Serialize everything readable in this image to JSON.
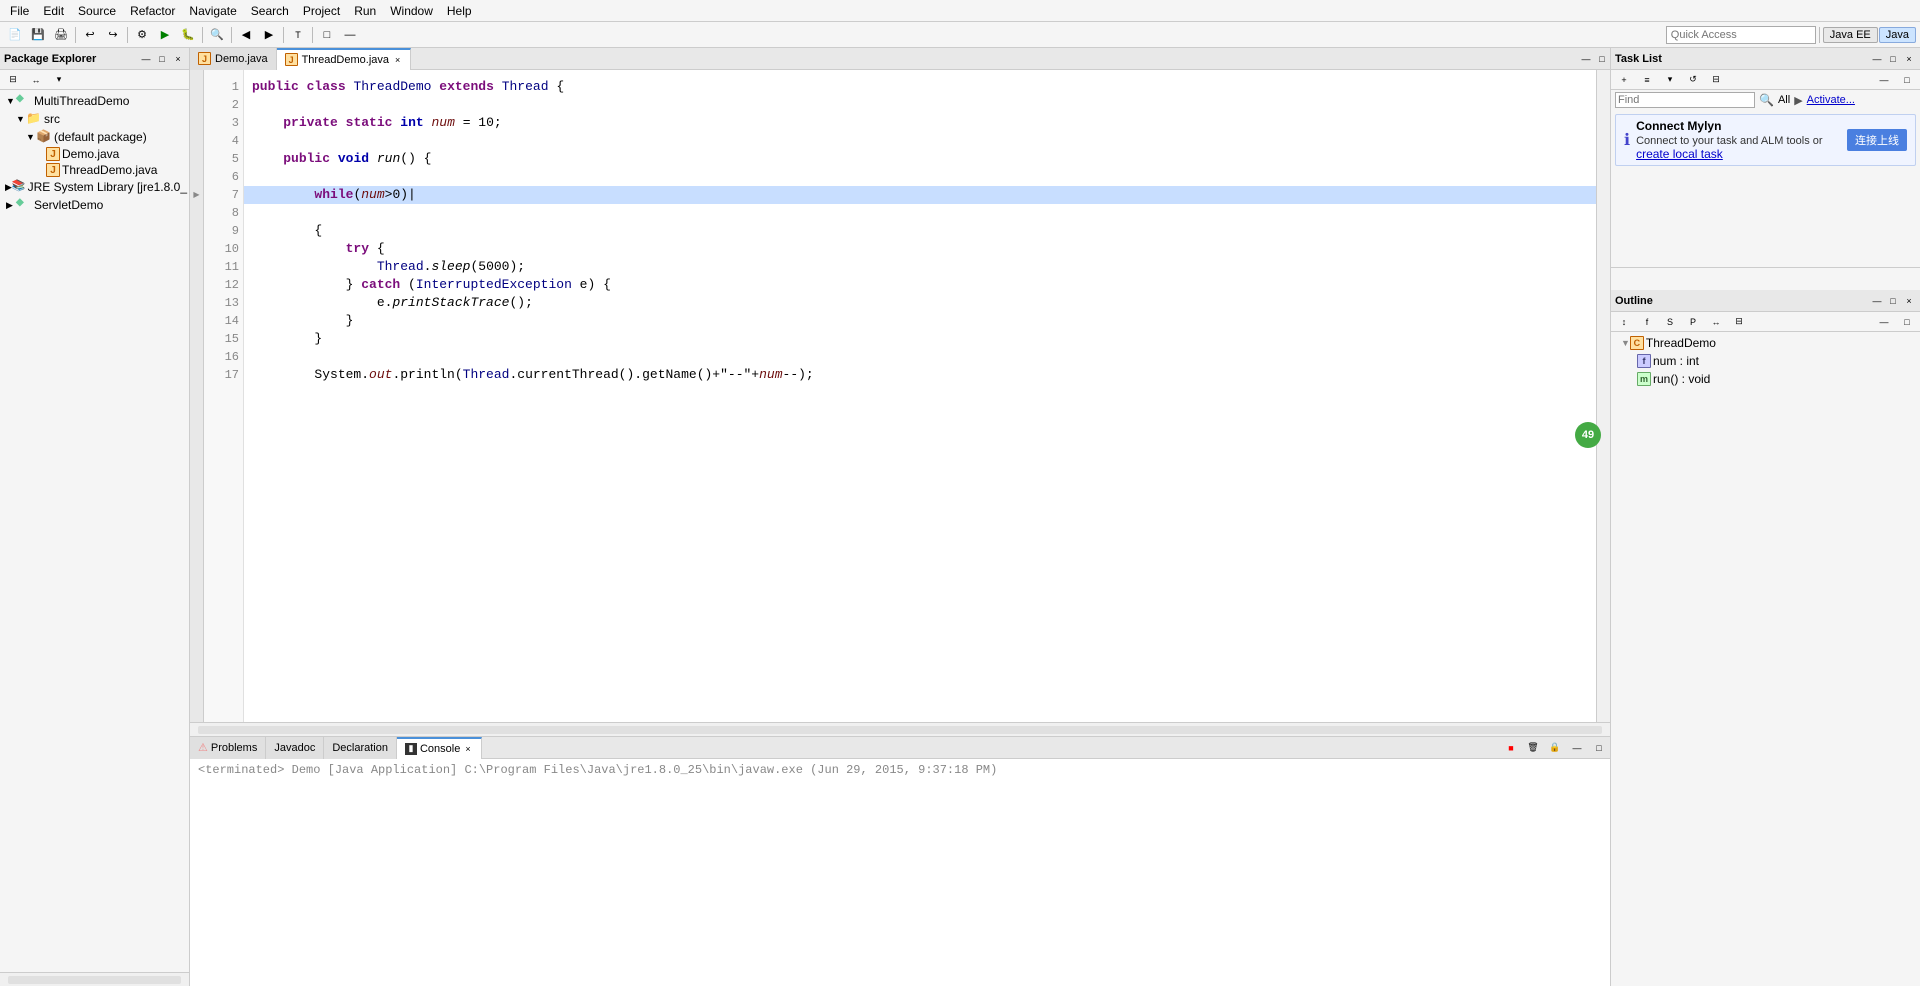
{
  "app": {
    "title": "Eclipse IDE"
  },
  "menubar": {
    "items": [
      "File",
      "Edit",
      "Source",
      "Refactor",
      "Navigate",
      "Search",
      "Project",
      "Run",
      "Window",
      "Help"
    ]
  },
  "quickaccess": {
    "placeholder": "Quick Access",
    "perspective1": "Java EE",
    "perspective2": "Java"
  },
  "left_panel": {
    "title": "Package Explorer",
    "close_label": "×",
    "minimize_label": "—",
    "maximize_label": "□",
    "tree": [
      {
        "label": "MultiThreadDemo",
        "type": "project",
        "indent": 0,
        "expanded": true
      },
      {
        "label": "src",
        "type": "folder",
        "indent": 1,
        "expanded": true
      },
      {
        "label": "(default package)",
        "type": "package",
        "indent": 2,
        "expanded": true
      },
      {
        "label": "Demo.java",
        "type": "java",
        "indent": 3
      },
      {
        "label": "ThreadDemo.java",
        "type": "java",
        "indent": 3
      },
      {
        "label": "JRE System Library [jre1.8.0_",
        "type": "library",
        "indent": 2
      },
      {
        "label": "ServletDemo",
        "type": "project",
        "indent": 0
      }
    ]
  },
  "editor": {
    "tabs": [
      {
        "label": "Demo.java",
        "active": false,
        "icon": "java-file-icon"
      },
      {
        "label": "ThreadDemo.java",
        "active": true,
        "icon": "java-file-icon"
      }
    ],
    "code_lines": [
      "",
      "public class ThreadDemo extends Thread {",
      "",
      "    private static int num = 10;",
      "",
      "    public void run() {",
      "",
      "        while(num>0)|",
      "        {",
      "            try {",
      "                Thread.sleep(5000);",
      "            } catch (InterruptedException e) {",
      "                e.printStackTrace();",
      "            }",
      "        }",
      "",
      "        System.out.println(Thread.currentThread().getName()+\"--\"+num--);",
      ""
    ],
    "highlight_line": 8
  },
  "bottom_panel": {
    "tabs": [
      "Problems",
      "Javadoc",
      "Declaration",
      "Console"
    ],
    "active_tab": "Console",
    "console_text": "<terminated> Demo [Java Application] C:\\Program Files\\Java\\jre1.8.0_25\\bin\\javaw.exe (Jun 29, 2015, 9:37:18 PM)"
  },
  "right_panel": {
    "task_list": {
      "title": "Task List",
      "find_placeholder": "Find",
      "all_label": "All",
      "activate_label": "Activate..."
    },
    "mylyn": {
      "connect_label": "Connect Mylyn",
      "description": "Connect to your task and ALM tools or",
      "link_label": "create local task",
      "button_label": "连接上线"
    },
    "outline": {
      "title": "Outline",
      "tree": [
        {
          "label": "ThreadDemo",
          "type": "class",
          "indent": 0,
          "expanded": true
        },
        {
          "label": "num : int",
          "type": "field",
          "indent": 1
        },
        {
          "label": "run() : void",
          "type": "method",
          "indent": 1
        }
      ]
    }
  },
  "icons": {
    "project": "▶",
    "folder": "📁",
    "package": "📦",
    "java_file": "J",
    "library": "📚",
    "class": "C",
    "field": "f",
    "method": "m",
    "search": "🔍",
    "collapse": "◀",
    "expand": "▶"
  }
}
